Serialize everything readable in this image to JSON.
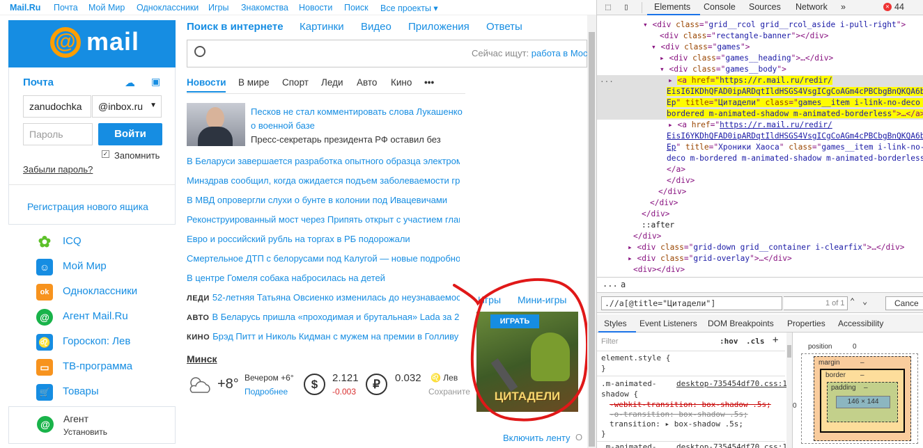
{
  "topnav": [
    "Mail.Ru",
    "Почта",
    "Мой Мир",
    "Одноклассники",
    "Игры",
    "Знакомства",
    "Новости",
    "Поиск",
    "Все проекты ▾"
  ],
  "logo": {
    "at": "@",
    "word": "mail"
  },
  "mailbox": {
    "title": "Почта",
    "login": "zanudochka",
    "domain": "@inbox.ru",
    "password_ph": "Пароль",
    "login_btn": "Войти",
    "remember": "Запомнить",
    "forgot": "Забыли пароль?",
    "register": "Регистрация нового ящика"
  },
  "services": [
    {
      "label": "ICQ",
      "color": "#5dc12a",
      "glyph": "✿"
    },
    {
      "label": "Мой Мир",
      "color": "#168de2",
      "glyph": "☺"
    },
    {
      "label": "Одноклассники",
      "color": "#f7931e",
      "glyph": "ok"
    },
    {
      "label": "Агент Mail.Ru",
      "color": "#19b34a",
      "glyph": "@"
    },
    {
      "label": "Гороскоп: Лев",
      "color": "#168de2",
      "glyph": "♌"
    },
    {
      "label": "ТВ-программа",
      "color": "#f7931e",
      "glyph": "▭"
    },
    {
      "label": "Товары",
      "color": "#168de2",
      "glyph": "🛒"
    }
  ],
  "agent": {
    "title": "Агент",
    "sub": "Установить"
  },
  "search_tabs": [
    "Поиск в интернете",
    "Картинки",
    "Видео",
    "Приложения",
    "Ответы"
  ],
  "search": {
    "hint": "Сейчас ищут:",
    "hint_link": "работа в Мос"
  },
  "news_tabs": [
    "Новости",
    "В мире",
    "Спорт",
    "Леди",
    "Авто",
    "Кино",
    "•••"
  ],
  "top_news": {
    "title1": "Песков не стал комментировать слова Лукашенко",
    "title2": "о военной базе",
    "sub": "Пресс-секретарь президента РФ оставил без"
  },
  "news": [
    "В Беларуси завершается разработка опытного образца электромо",
    "Минздрав сообщил, когда ожидается подъем заболеваемости гр",
    "В МВД опровергли слухи о бунте в колонии под Ивацевичами",
    "Реконструированный мост через Припять открыт с участием глав",
    "Евро и российский рубль на торгах в РБ подорожали",
    "Смертельное ДТП с белорусами под Калугой — новые подробно",
    "В центре Гомеля собака набросилась на детей"
  ],
  "cat_news": [
    {
      "cat": "ЛЕДИ",
      "text": "52-летняя Татьяна Овсиенко изменилась до неузнаваемос"
    },
    {
      "cat": "АВТО",
      "text": "В Беларусь пришла «проходимая и брутальная» Lada за 2"
    },
    {
      "cat": "КИНО",
      "text": "Брэд Питт и Николь Кидман с мужем на премии в Голливу"
    }
  ],
  "weather": {
    "city": "Минск",
    "temp": "+8°",
    "evening": "Вечером +6°",
    "more": "Подробнее",
    "usd": "2.121",
    "usd_delta": "-0.003",
    "rub": "0.032",
    "zodiac": "♌ Лев",
    "zodiac_sub": "Сохраните"
  },
  "games": {
    "tab1": "Игры",
    "tab2": "Мини-игры",
    "play": "ИГРАТЬ",
    "title": "ЦИТАДЕЛИ"
  },
  "feed": "Включить ленту",
  "devtools": {
    "tabs": [
      "Elements",
      "Console",
      "Sources",
      "Network",
      "»"
    ],
    "errors": "44",
    "crumbs": [
      "...",
      "a"
    ],
    "xpath": ".//a[@title=\"Цитадели\"]",
    "match": "1 of 1",
    "cancel": "Cance",
    "style_tabs": [
      "Styles",
      "Event Listeners",
      "DOM Breakpoints",
      "Properties",
      "Accessibility"
    ],
    "filter": "Filter",
    "hov": ":hov",
    "cls": ".cls",
    "plus": "+",
    "rules": {
      "es": "element.style {",
      "close": "}",
      "sel1": ".m-animated-",
      "sel1b": "shadow {",
      "src": "desktop-735454df70.css:1",
      "p1": "-webkit-transition: box-shadow .5s;",
      "p2": "-o-transition: box-shadow .5s;",
      "p3": "transition: ▸ box-shadow .5s;",
      "sel2": ".m-animated-",
      "src2": "desktop-735454df70.css:1"
    },
    "box": {
      "position": "position",
      "pos_val": "0",
      "margin": "margin",
      "border": "border",
      "padding": "padding",
      "dash": "–",
      "size": "146 × 144"
    }
  }
}
